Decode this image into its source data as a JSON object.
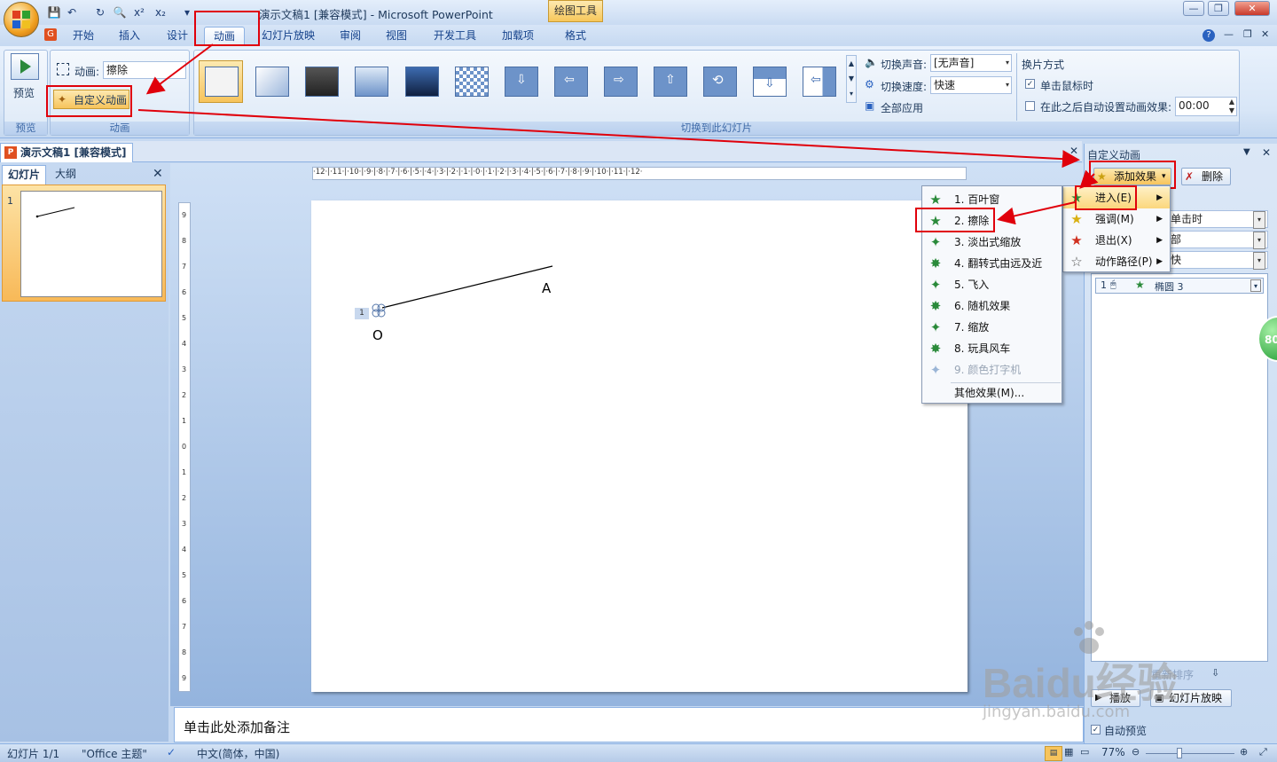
{
  "window": {
    "title": "演示文稿1 [兼容模式] - Microsoft PowerPoint",
    "context_tab": "绘图工具"
  },
  "quick_access": [
    "💾",
    "↶",
    "↻",
    "🔍",
    "x²",
    "x₂",
    "▾"
  ],
  "tabs": [
    "开始",
    "插入",
    "设计",
    "动画",
    "幻灯片放映",
    "审阅",
    "视图",
    "开发工具",
    "加载项",
    "格式"
  ],
  "ribbon": {
    "preview_label": "预览",
    "preview_group": "预览",
    "animation_label": "动画:",
    "animation_value": "擦除",
    "custom_animation_button": "自定义动画",
    "animation_group": "动画",
    "transition_group": "切换到此幻灯片",
    "sound_label": "切换声音:",
    "sound_value": "[无声音]",
    "speed_label": "切换速度:",
    "speed_value": "快速",
    "apply_all": "全部应用",
    "advance_title": "换片方式",
    "on_click": "单击鼠标时",
    "auto_after": "在此之后自动设置动画效果:",
    "auto_time": "00:00"
  },
  "document_tab": "演示文稿1 [兼容模式]",
  "left_pane": {
    "slides_tab": "幻灯片",
    "outline_tab": "大纲",
    "slide_number": "1"
  },
  "ruler": {
    "horizontal": "·12·|·11·|·10·|·9·|·8·|·7·|·6·|·5·|·4·|·3·|·2·|·1·|·0·|·1·|·2·|·3·|·4·|·5·|·6·|·7·|·8·|·9·|·10·|·11·|·12·",
    "vertical": [
      "9",
      "8",
      "7",
      "6",
      "5",
      "4",
      "3",
      "2",
      "1",
      "0",
      "1",
      "2",
      "3",
      "4",
      "5",
      "6",
      "7",
      "8",
      "9"
    ]
  },
  "slide": {
    "label_a": "A",
    "label_o": "O",
    "anim_tag": "1"
  },
  "notes_placeholder": "单击此处添加备注",
  "task_pane": {
    "title": "自定义动画",
    "add_effect": "添加效果",
    "remove": "删除",
    "start_value": "单击时",
    "property_value": "部",
    "speed_value": "快",
    "list_item_num": "1",
    "list_item_name": "椭圆 3",
    "play": "播放",
    "slideshow": "幻灯片放映",
    "auto_preview": "自动预览",
    "reorder": "重新排序"
  },
  "add_menu": [
    {
      "label": "进入(E)",
      "icon": "star-green"
    },
    {
      "label": "强调(M)",
      "icon": "star-yellow"
    },
    {
      "label": "退出(X)",
      "icon": "star-red"
    },
    {
      "label": "动作路径(P)",
      "icon": "star-outline"
    }
  ],
  "entrance_menu": [
    {
      "label": "1. 百叶窗",
      "enabled": true
    },
    {
      "label": "2. 擦除",
      "enabled": true
    },
    {
      "label": "3. 淡出式缩放",
      "enabled": true
    },
    {
      "label": "4. 翻转式由远及近",
      "enabled": true
    },
    {
      "label": "5. 飞入",
      "enabled": true
    },
    {
      "label": "6. 随机效果",
      "enabled": true
    },
    {
      "label": "7. 缩放",
      "enabled": true
    },
    {
      "label": "8. 玩具风车",
      "enabled": true
    },
    {
      "label": "9. 颜色打字机",
      "enabled": false
    }
  ],
  "more_effects": "其他效果(M)...",
  "status_bar": {
    "slide_info": "幻灯片 1/1",
    "theme": "\"Office 主题\"",
    "language": "中文(简体，中国)",
    "zoom": "77%"
  },
  "badge": "80",
  "watermark": {
    "brand": "Baidu经验",
    "url": "jingyan.baidu.com"
  },
  "colors": {
    "ribbon": "#d8e6f7",
    "highlight_red": "#e0000b",
    "menu_hover": "#fde3a6",
    "star_green": "#2a8a3a"
  }
}
